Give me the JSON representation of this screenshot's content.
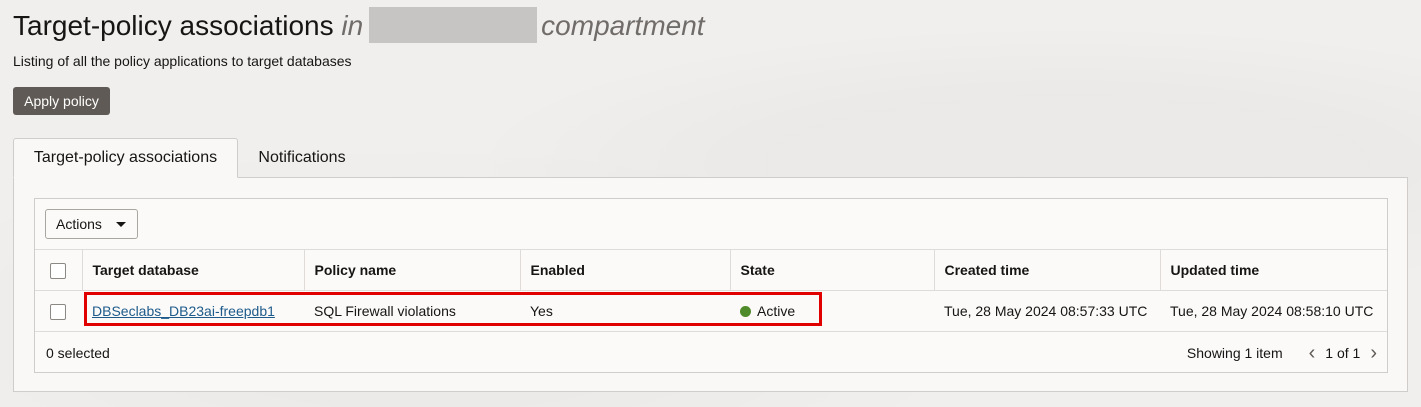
{
  "header": {
    "title": "Target-policy associations",
    "in_word": "in",
    "compartment_word": "compartment",
    "subtitle": "Listing of all the policy applications to target databases",
    "apply_button": "Apply policy"
  },
  "tabs": [
    {
      "label": "Target-policy associations",
      "active": true
    },
    {
      "label": "Notifications",
      "active": false
    }
  ],
  "toolbar": {
    "actions_label": "Actions"
  },
  "table": {
    "columns": [
      "Target database",
      "Policy name",
      "Enabled",
      "State",
      "Created time",
      "Updated time"
    ],
    "rows": [
      {
        "target_database": "DBSeclabs_DB23ai-freepdb1",
        "policy_name": "SQL Firewall violations",
        "enabled": "Yes",
        "state": "Active",
        "created_time": "Tue, 28 May 2024 08:57:33 UTC",
        "updated_time": "Tue, 28 May 2024 08:58:10 UTC"
      }
    ]
  },
  "footer": {
    "selected": "0 selected",
    "showing": "Showing 1 item",
    "page": "1 of 1"
  },
  "colors": {
    "state_active": "#4f8b2a",
    "highlight": "#e00000",
    "primary_button": "#5f5a55"
  }
}
